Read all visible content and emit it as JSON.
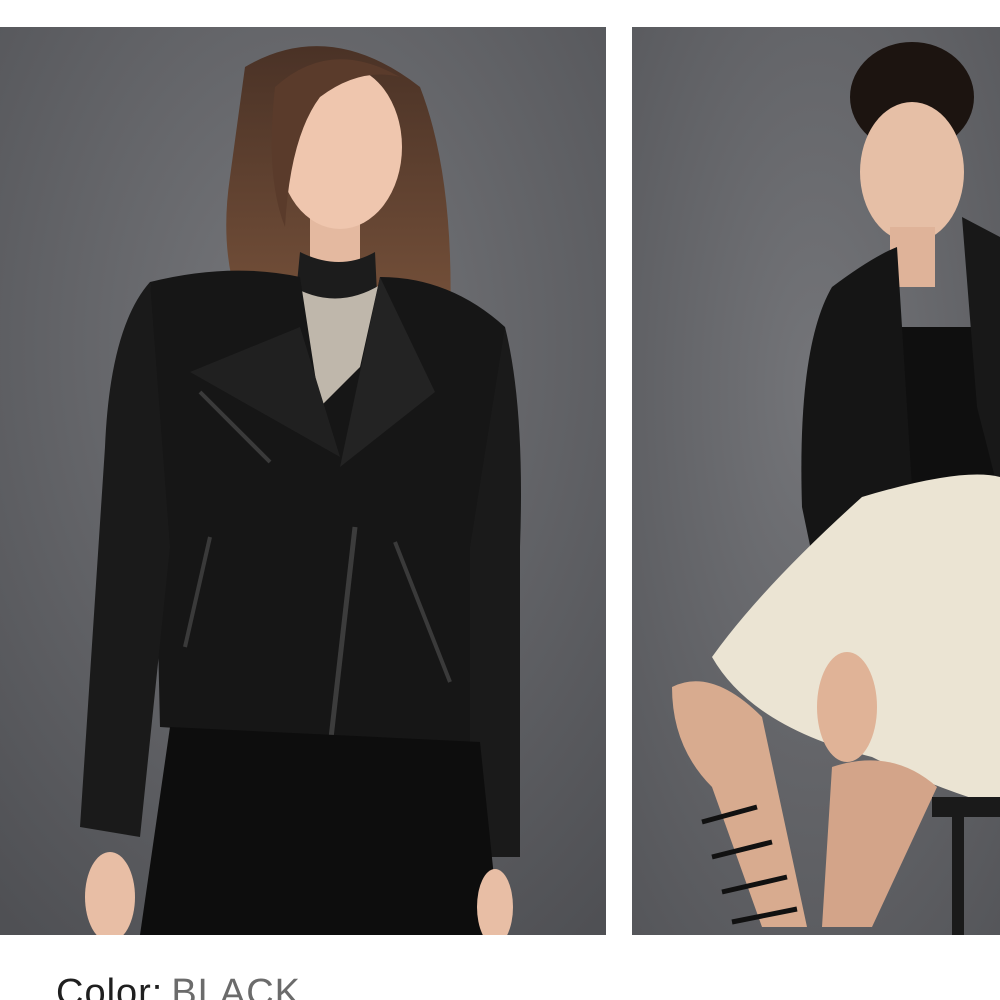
{
  "product": {
    "color_label": "Color:",
    "color_value": "BLACK"
  },
  "gallery": {
    "images": [
      {
        "icon": "model-image",
        "alt": ""
      },
      {
        "icon": "model-image",
        "alt": ""
      }
    ]
  },
  "colors": {
    "background": "#ffffff",
    "studio_backdrop": "#5f6064",
    "jacket": "#141414",
    "skirt_cream": "#ebe4d3"
  }
}
